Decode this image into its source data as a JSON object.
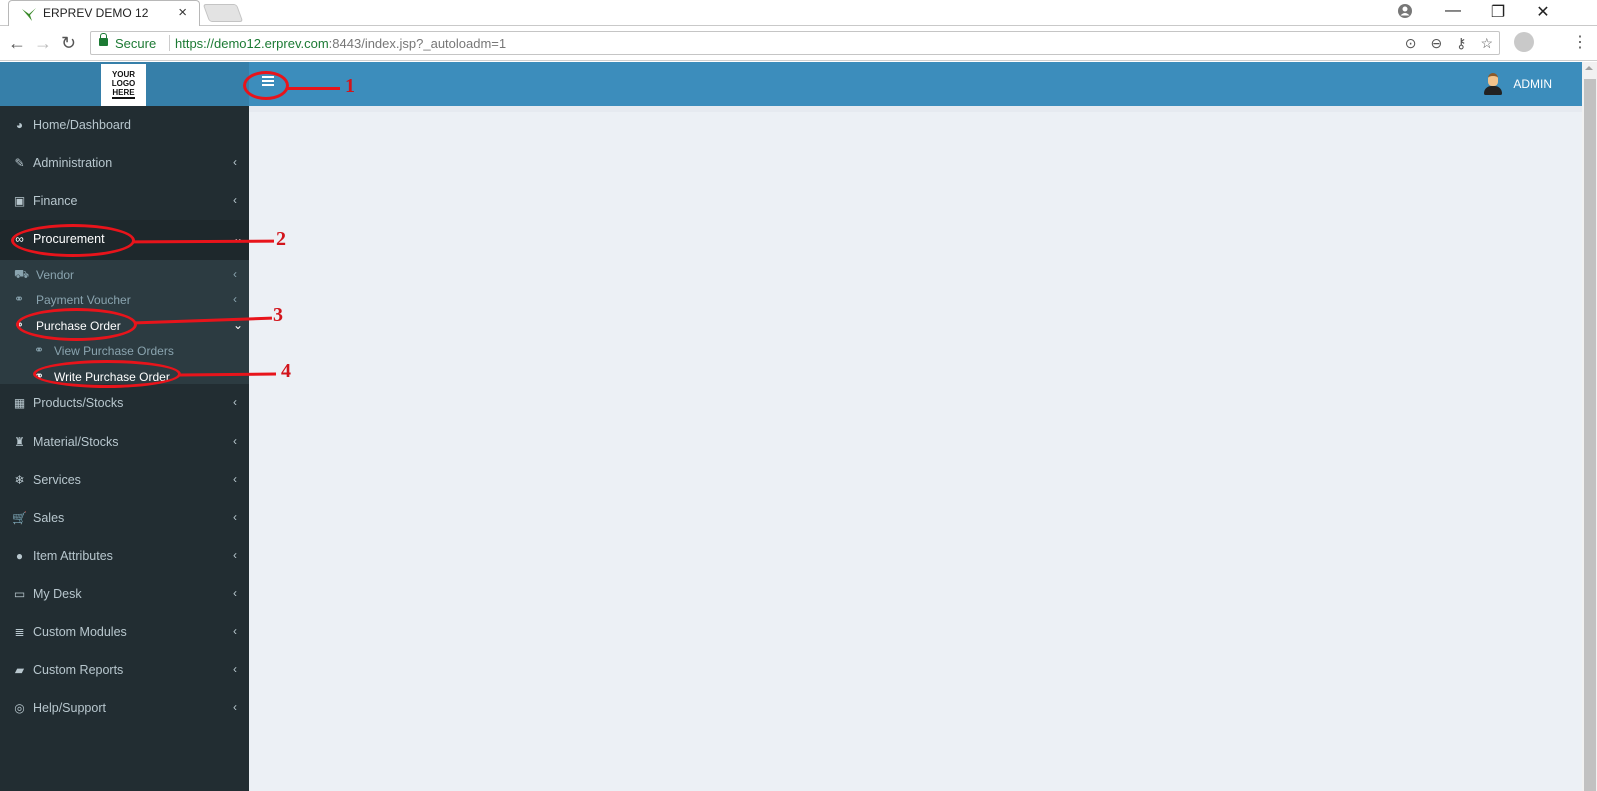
{
  "browser": {
    "tab_title": "ERPREV DEMO 12",
    "tab_close": "×",
    "security_label": "Secure",
    "url_host": "https://demo12.erprev.com",
    "url_rest": ":8443/index.jsp?_autoloadm=1",
    "nav_back": "←",
    "nav_forward": "→",
    "nav_reload": "↻",
    "win_min": "—",
    "win_max": "❐",
    "win_close": "✕",
    "omni_icons": [
      "⊙",
      "⊖",
      "⚷",
      "☆"
    ],
    "menu": "⋮"
  },
  "header": {
    "logo_lines": [
      "YOUR",
      "LOGO",
      "HERE"
    ],
    "user_name": "ADMIN"
  },
  "sidebar": {
    "items": [
      {
        "label": "Home/Dashboard",
        "icon": "dashboard-icon",
        "glyph": "◕",
        "chevron": ""
      },
      {
        "label": "Administration",
        "icon": "ticket-icon",
        "glyph": "✎",
        "chevron": "‹"
      },
      {
        "label": "Finance",
        "icon": "money-icon",
        "glyph": "▣",
        "chevron": "‹"
      },
      {
        "label": "Procurement",
        "icon": "binoculars-icon",
        "glyph": "∞",
        "chevron": "⌄"
      },
      {
        "label": "Products/Stocks",
        "icon": "building-icon",
        "glyph": "▦",
        "chevron": "‹"
      },
      {
        "label": "Material/Stocks",
        "icon": "trash-icon",
        "glyph": "♜",
        "chevron": "‹"
      },
      {
        "label": "Services",
        "icon": "snowflake-icon",
        "glyph": "❄",
        "chevron": "‹"
      },
      {
        "label": "Sales",
        "icon": "cart-icon",
        "glyph": "🛒",
        "chevron": "‹"
      },
      {
        "label": "Item Attributes",
        "icon": "attributes-icon",
        "glyph": "●",
        "chevron": "‹"
      },
      {
        "label": "My Desk",
        "icon": "desktop-icon",
        "glyph": "▭",
        "chevron": "‹"
      },
      {
        "label": "Custom Modules",
        "icon": "database-icon",
        "glyph": "≣",
        "chevron": "‹"
      },
      {
        "label": "Custom Reports",
        "icon": "book-icon",
        "glyph": "▰",
        "chevron": "‹"
      },
      {
        "label": "Help/Support",
        "icon": "lifering-icon",
        "glyph": "◎",
        "chevron": "‹"
      }
    ],
    "procurement_sub": [
      {
        "label": "Vendor",
        "glyph": "⛟",
        "chevron": "‹"
      },
      {
        "label": "Payment Voucher",
        "glyph": "⚭",
        "chevron": "‹"
      },
      {
        "label": "Purchase Order",
        "glyph": "⚭",
        "chevron": "⌄"
      },
      {
        "label": "View Purchase Orders",
        "glyph": "⚭",
        "chevron": ""
      },
      {
        "label": "Write Purchase Order",
        "glyph": "⚭",
        "chevron": ""
      }
    ]
  },
  "annotations": [
    "1",
    "2",
    "3",
    "4"
  ],
  "colors": {
    "header": "#3c8dbc",
    "sidebar": "#222d32",
    "content": "#ecf0f5",
    "annotation": "#e8141b"
  }
}
